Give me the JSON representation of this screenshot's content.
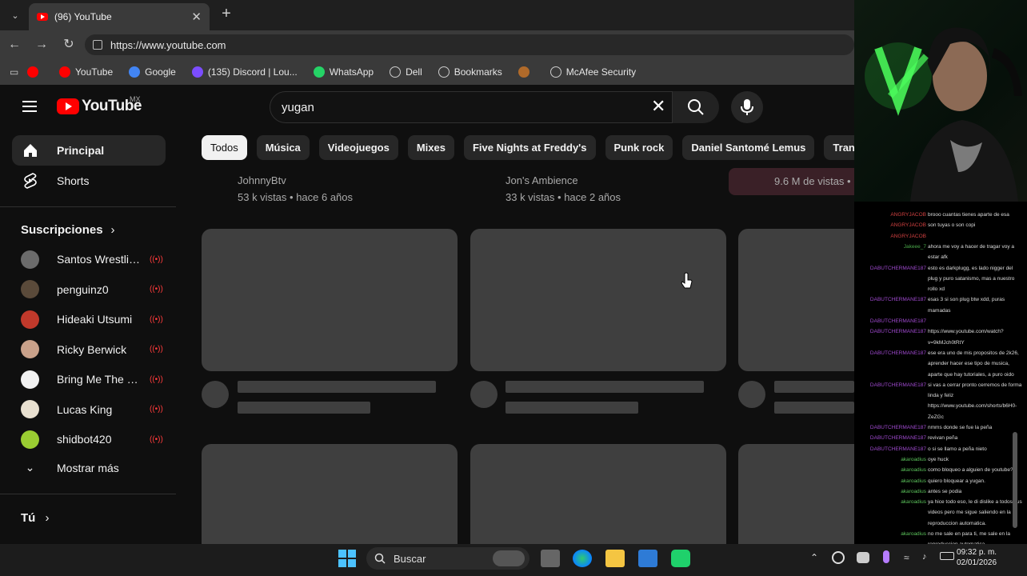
{
  "browser": {
    "tab_title": "(96) YouTube",
    "url": "https://www.youtube.com",
    "bookmarks": [
      {
        "label": "",
        "icon": "youtube-icon",
        "color": "#ff0000"
      },
      {
        "label": "YouTube",
        "icon": "youtube-icon",
        "color": "#ff0000"
      },
      {
        "label": "Google",
        "icon": "google-icon",
        "color": "#4285f4"
      },
      {
        "label": "(135) Discord | Lou...",
        "icon": "discord-icon",
        "color": "#7c4dff"
      },
      {
        "label": "WhatsApp",
        "icon": "whatsapp-icon",
        "color": "#25d366"
      },
      {
        "label": "Dell",
        "icon": "folder-icon",
        "color": "#3a3a3a"
      },
      {
        "label": "Bookmarks",
        "icon": "globe-icon",
        "color": "#3a3a3a"
      },
      {
        "label": "",
        "icon": "bookmark-icon",
        "color": "#b06a2a"
      },
      {
        "label": "McAfee Security",
        "icon": "globe-icon",
        "color": "#3a3a3a"
      }
    ]
  },
  "youtube": {
    "logo_text": "YouTube",
    "region": "MX",
    "search_value": "yugan",
    "nav": {
      "home": "Principal",
      "shorts": "Shorts"
    },
    "subscriptions_title": "Suscripciones",
    "subscriptions": [
      {
        "name": "Santos Wrestling...",
        "color": "#6b6b6b"
      },
      {
        "name": "penguinz0",
        "color": "#5a4a3a"
      },
      {
        "name": "Hideaki Utsumi",
        "color": "#c0392b"
      },
      {
        "name": "Ricky Berwick",
        "color": "#c9a18a"
      },
      {
        "name": "Bring Me The Ho...",
        "color": "#f1f1f1"
      },
      {
        "name": "Lucas King",
        "color": "#e8e0d0"
      },
      {
        "name": "shidbot420",
        "color": "#9acd32"
      }
    ],
    "show_more": "Mostrar más",
    "you": "Tú",
    "chips": [
      "Todos",
      "Música",
      "Videojuegos",
      "Mixes",
      "Five Nights at Freddy's",
      "Punk rock",
      "Daniel Santomé Lemus",
      "Transfon"
    ],
    "prev_row": [
      {
        "channel": "JohnnyBtv",
        "stats": "53 k vistas • hace 6 años"
      },
      {
        "channel": "Jon's Ambience",
        "stats": "33 k vistas • hace 2 años"
      },
      {
        "channel": "",
        "stats": "9.6 M de vistas •"
      }
    ]
  },
  "chat": [
    {
      "user": "ANGRYJACOB",
      "color": "#d04040",
      "msg": "brooo cuantas tienes aparte de esa"
    },
    {
      "user": "ANGRYJACOB",
      "color": "#d04040",
      "msg": "son tuyas o son copi"
    },
    {
      "user": "ANGRYJACOB",
      "color": "#d04040",
      "msg": ""
    },
    {
      "user": "Jakeee_7",
      "color": "#4aa84a",
      "msg": "ahora me voy a hacer de tragar voy a"
    },
    {
      "user": "",
      "color": "#4aa84a",
      "msg": "estar afk"
    },
    {
      "user": "DABUTCHERMANE187",
      "color": "#a04ad0",
      "msg": "esto es darkplugg, es lado nigger del"
    },
    {
      "user": "",
      "color": "#a04ad0",
      "msg": "plug y puro satanismo, mas a nuestro"
    },
    {
      "user": "",
      "color": "#a04ad0",
      "msg": "rollo xd"
    },
    {
      "user": "DABUTCHERMANE187",
      "color": "#a04ad0",
      "msg": "esas 3 si son plug btw xdd, puras"
    },
    {
      "user": "",
      "color": "#a04ad0",
      "msg": "mamadas"
    },
    {
      "user": "DABUTCHERMANE187",
      "color": "#a04ad0",
      "msg": ""
    },
    {
      "user": "DABUTCHERMANE187",
      "color": "#a04ad0",
      "msg": "https://www.youtube.com/watch?"
    },
    {
      "user": "",
      "color": "#a04ad0",
      "msg": "v=9kMJch0tRtY"
    },
    {
      "user": "DABUTCHERMANE187",
      "color": "#a04ad0",
      "msg": "ese era uno de mis propositos de 2k26,"
    },
    {
      "user": "",
      "color": "#a04ad0",
      "msg": "aprender hacer ese tipo de musica,"
    },
    {
      "user": "",
      "color": "#a04ad0",
      "msg": "aparte que hay tutoriales, a puro oido"
    },
    {
      "user": "DABUTCHERMANE187",
      "color": "#a04ad0",
      "msg": "si vas a cerrar pronto cerremos de forma"
    },
    {
      "user": "",
      "color": "#a04ad0",
      "msg": "linda y feliz"
    },
    {
      "user": "",
      "color": "#a04ad0",
      "msg": "https://www.youtube.com/shorts/b6H0-"
    },
    {
      "user": "",
      "color": "#a04ad0",
      "msg": "ZeZGc"
    },
    {
      "user": "DABUTCHERMANE187",
      "color": "#a04ad0",
      "msg": "nmms donde se fue la peña"
    },
    {
      "user": "DABUTCHERMANE187",
      "color": "#a04ad0",
      "msg": "revivan peña"
    },
    {
      "user": "DABUTCHERMANE187",
      "color": "#a04ad0",
      "msg": "o si se llamo a peña nieto"
    },
    {
      "user": "akaroadius",
      "color": "#5ac05a",
      "msg": "oye huck"
    },
    {
      "user": "akaroadius",
      "color": "#5ac05a",
      "msg": "como bloqueo a alguien de youtube?"
    },
    {
      "user": "akaroadius",
      "color": "#5ac05a",
      "msg": "quiero bloquear a yugan."
    },
    {
      "user": "akaroadius",
      "color": "#5ac05a",
      "msg": "antes se podia"
    },
    {
      "user": "akaroadius",
      "color": "#5ac05a",
      "msg": "ya hice todo eso, le di dislike a todos sus"
    },
    {
      "user": "",
      "color": "#5ac05a",
      "msg": "videos pero me sigue saliendo en la"
    },
    {
      "user": "",
      "color": "#5ac05a",
      "msg": "reproduccion automatica."
    },
    {
      "user": "akaroadius",
      "color": "#5ac05a",
      "msg": "no me sale en para ti, me sale en la"
    },
    {
      "user": "",
      "color": "#5ac05a",
      "msg": "reproduccion automatica"
    }
  ],
  "taskbar": {
    "search_placeholder": "Buscar",
    "time": "09:32 p. m.",
    "date": "02/01/2026"
  }
}
